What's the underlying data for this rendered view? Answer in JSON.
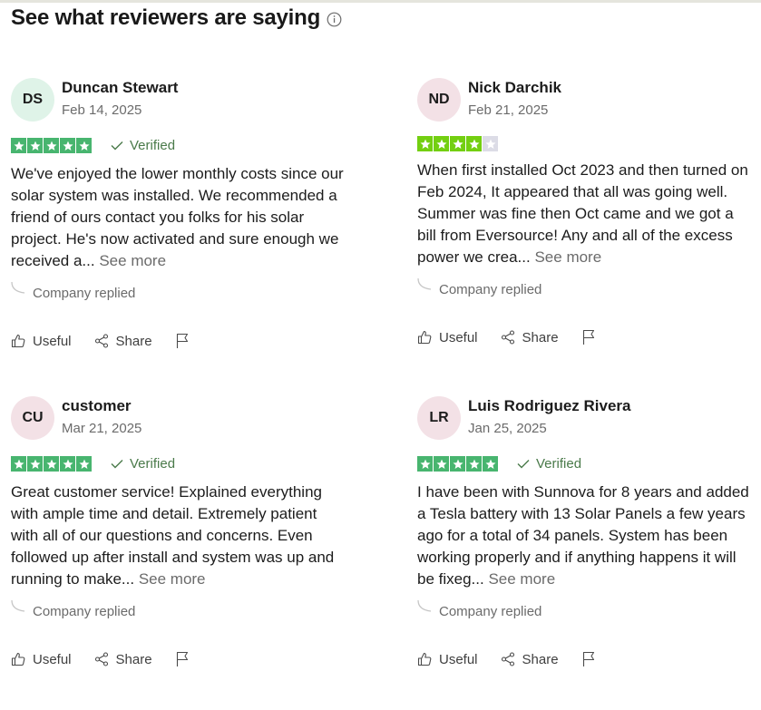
{
  "section": {
    "title": "See what reviewers are saying"
  },
  "colors": {
    "star_green": "#73cf11",
    "star_green_dark": "#48b56f",
    "star_empty": "#dcdce6",
    "verified": "#4a7a4a"
  },
  "reviews": [
    {
      "initials": "DS",
      "avatar_color": "#dff3e8",
      "name": "Duncan Stewart",
      "date": "Feb 14, 2025",
      "rating": 5,
      "verified_label": "Verified",
      "text": "We've enjoyed the lower monthly costs since our solar system was installed. We recommended a friend of ours contact you folks for his solar project. He's now activated and sure enough we received a...",
      "see_more": "See more",
      "replied": "Company replied",
      "useful": "Useful",
      "share": "Share"
    },
    {
      "initials": "ND",
      "avatar_color": "#f3e1e6",
      "name": "Nick Darchik",
      "date": "Feb 21, 2025",
      "rating": 4,
      "verified_label": "",
      "text": "When first installed Oct 2023 and then turned on Feb 2024, It appeared that all was going well. Summer was fine then Oct came and we got a bill from Eversource! Any and all of the excess power we crea...",
      "see_more": "See more",
      "replied": "Company replied",
      "useful": "Useful",
      "share": "Share"
    },
    {
      "initials": "CU",
      "avatar_color": "#f3e1e6",
      "name": "customer",
      "date": "Mar 21, 2025",
      "rating": 5,
      "verified_label": "Verified",
      "text": "Great customer service! Explained everything with ample time and detail. Extremely patient with all of our questions and concerns. Even followed up after install and system was up and running to make...",
      "see_more": "See more",
      "replied": "Company replied",
      "useful": "Useful",
      "share": "Share"
    },
    {
      "initials": "LR",
      "avatar_color": "#f3e1e6",
      "name": "Luis Rodriguez Rivera",
      "date": "Jan 25, 2025",
      "rating": 5,
      "verified_label": "Verified",
      "text": "I have been with Sunnova for 8 years and added a Tesla battery with 13 Solar Panels a few years ago for a total of 34 panels. System has been working properly and if anything happens it will be fixeg...",
      "see_more": "See more",
      "replied": "Company replied",
      "useful": "Useful",
      "share": "Share"
    }
  ]
}
